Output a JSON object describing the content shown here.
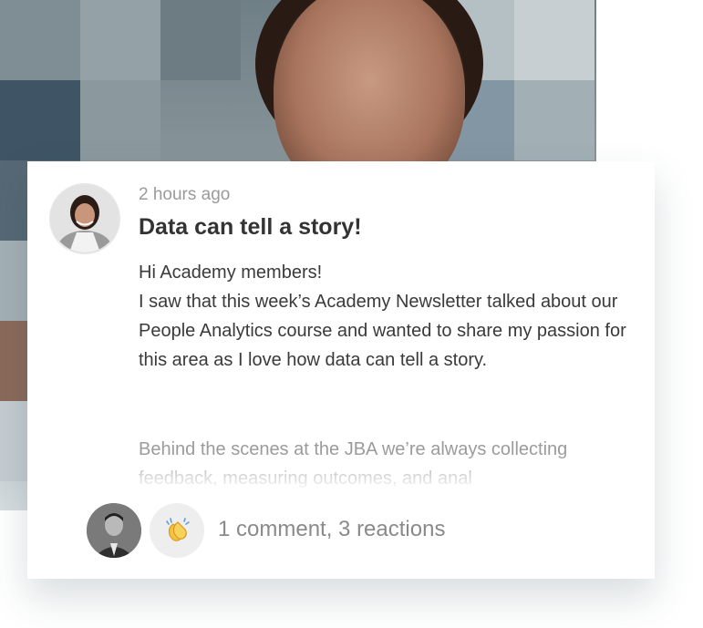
{
  "post": {
    "time_ago": "2 hours ago",
    "title": "Data can tell a story!",
    "greeting": "Hi Academy members!",
    "body": "I saw that this week’s Academy Newsletter talked about our People Analytics course and wanted to share my passion for this area as I love how data can tell a story.",
    "preview": "Behind the scenes at the JBA we’re always collecting feedback, measuring outcomes, and anal",
    "author_avatar": "author-avatar",
    "footer": {
      "commenter_avatar": "commenter-avatar",
      "reaction_icon": "clapping-hands-icon",
      "summary": "1 comment, 3 reactions"
    }
  }
}
